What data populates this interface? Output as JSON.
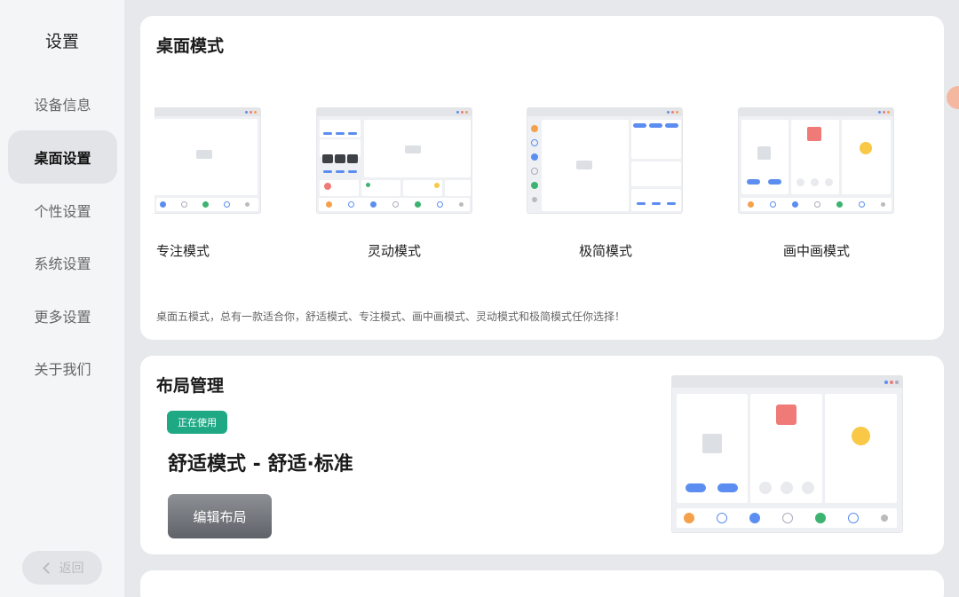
{
  "sidebar": {
    "title": "设置",
    "items": [
      {
        "label": "设备信息",
        "active": false
      },
      {
        "label": "桌面设置",
        "active": true
      },
      {
        "label": "个性设置",
        "active": false
      },
      {
        "label": "系统设置",
        "active": false
      },
      {
        "label": "更多设置",
        "active": false
      },
      {
        "label": "关于我们",
        "active": false
      }
    ],
    "back_label": "返回"
  },
  "desktop_modes": {
    "title": "桌面模式",
    "modes": [
      {
        "label": "专注模式"
      },
      {
        "label": "灵动模式"
      },
      {
        "label": "极简模式"
      },
      {
        "label": "画中画模式"
      }
    ],
    "description": "桌面五模式，总有一款适合你，舒适模式、专注模式、画中画模式、灵动模式和极简模式任你选择！"
  },
  "layout": {
    "title": "布局管理",
    "badge": "正在使用",
    "current_layout": "舒适模式 - 舒适·标准",
    "edit_label": "编辑布局"
  },
  "colors": {
    "accent_blue": "#5b8ef0",
    "badge_green": "#1fa884",
    "mock_red": "#f07a78",
    "mock_yellow": "#f8c846",
    "mock_orange": "#f5a04a",
    "mock_green": "#3cb371"
  }
}
